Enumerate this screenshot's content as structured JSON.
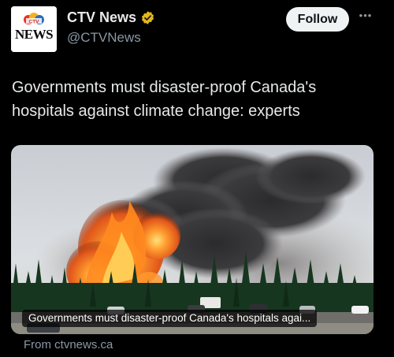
{
  "account": {
    "display_name": "CTV News",
    "handle": "@CTVNews",
    "avatar_logo_text": "NEWS",
    "avatar_icon": "ctv-logo",
    "verified_icon": "verified-badge-icon",
    "verified_color": "#e2b719"
  },
  "actions": {
    "follow_label": "Follow",
    "more_icon": "more-icon"
  },
  "post": {
    "text": "Governments must disaster-proof Canada's hospitals against climate change: experts"
  },
  "card": {
    "caption": "Governments must disaster-proof Canada's hospitals agai...",
    "source": "From ctvnews.ca"
  },
  "colors": {
    "background": "#000000",
    "text_primary": "#e7e9ea",
    "text_secondary": "#8b98a5",
    "button_bg": "#eff3f4"
  }
}
